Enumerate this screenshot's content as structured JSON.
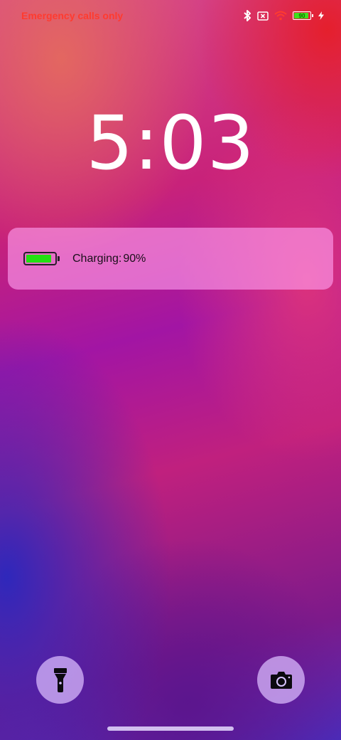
{
  "status_bar": {
    "carrier_text": "Emergency calls only",
    "battery_text": "90",
    "battery_level": 0.9,
    "icons": [
      "bluetooth-icon",
      "no-sim-icon",
      "wifi-icon",
      "battery-icon",
      "charging-bolt-icon"
    ],
    "colors": {
      "carrier": "#ff3b2f",
      "wifi": "#ff3b2f",
      "battery_fill": "#3ee01c"
    }
  },
  "lock_screen": {
    "time": "5:03",
    "charging_card": {
      "label": "Charging:",
      "percent": "90%",
      "battery_level": 0.9,
      "battery_color": "#22e012"
    },
    "quick_actions": [
      {
        "name": "flashlight",
        "icon": "flashlight-icon"
      },
      {
        "name": "camera",
        "icon": "camera-icon"
      }
    ]
  }
}
